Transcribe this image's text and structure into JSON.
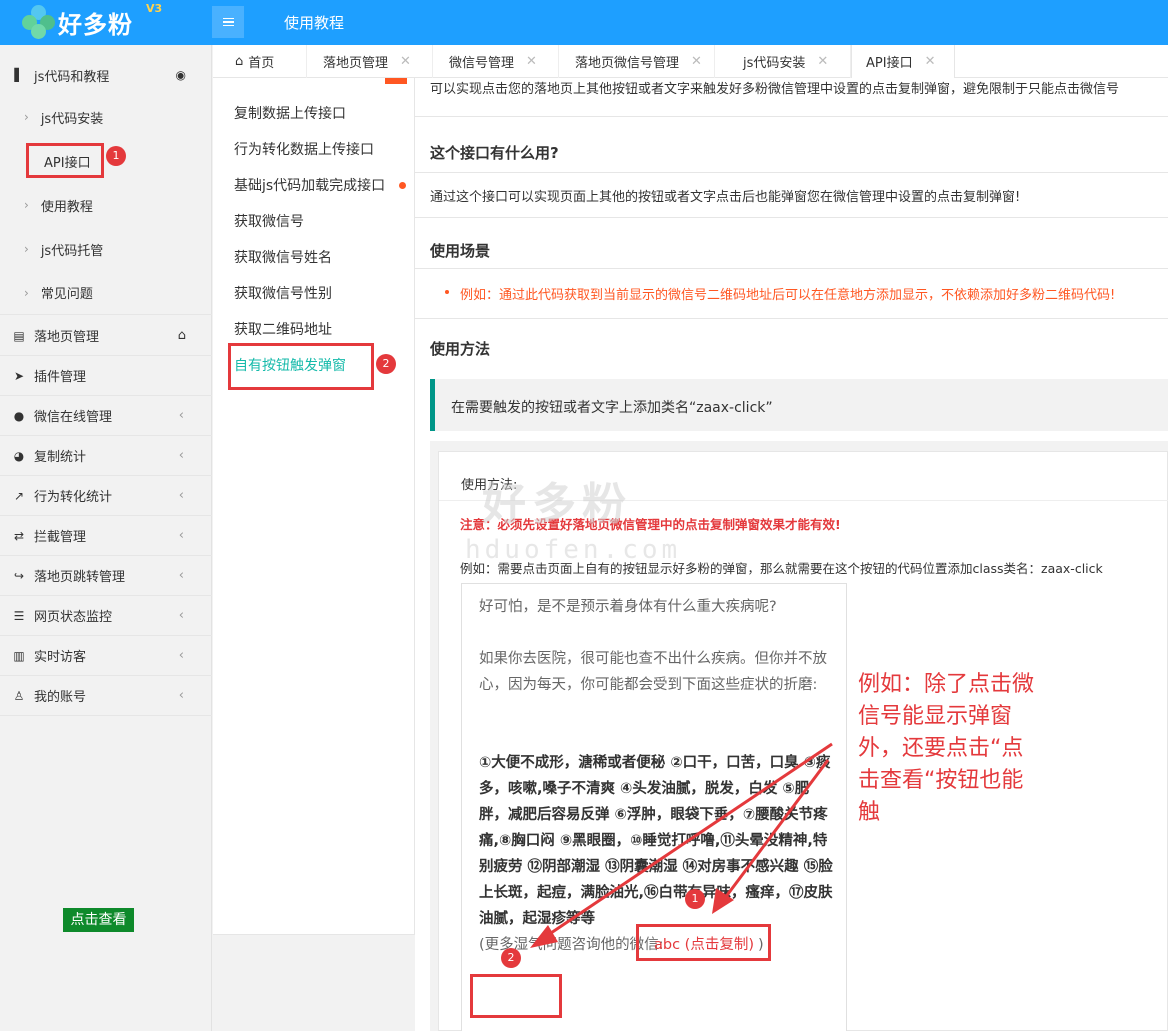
{
  "header": {
    "logo_text": "好多粉",
    "logo_version": "V3",
    "title": "使用教程"
  },
  "sidebar": {
    "group_title": "js代码和教程",
    "sub_items": [
      "js代码安装",
      "API接口",
      "使用教程",
      "js代码托管",
      "常见问题"
    ],
    "items": [
      {
        "label": "落地页管理",
        "icon": "file-icon"
      },
      {
        "label": "插件管理",
        "icon": "send-icon"
      },
      {
        "label": "微信在线管理",
        "icon": "wechat-icon"
      },
      {
        "label": "复制统计",
        "icon": "pie-chart-icon"
      },
      {
        "label": "行为转化统计",
        "icon": "line-chart-icon"
      },
      {
        "label": "拦截管理",
        "icon": "swap-icon"
      },
      {
        "label": "落地页跳转管理",
        "icon": "share-icon"
      },
      {
        "label": "网页状态监控",
        "icon": "server-icon"
      },
      {
        "label": "实时访客",
        "icon": "bar-chart-icon"
      },
      {
        "label": "我的账号",
        "icon": "user-icon"
      }
    ]
  },
  "tabs": [
    "首页",
    "落地页管理",
    "微信号管理",
    "落地页微信号管理",
    "js代码安装",
    "API接口"
  ],
  "midnav": {
    "items": [
      "复制数据上传接口",
      "行为转化数据上传接口",
      "基础js代码加载完成接口",
      "获取微信号",
      "获取微信号姓名",
      "获取微信号性别",
      "获取二维码地址",
      "自有按钮触发弹窗"
    ]
  },
  "content": {
    "intro": "可以实现点击您的落地页上其他按钮或者文字来触发好多粉微信管理中设置的点击复制弹窗，避免限制于只能点击微信号",
    "h1": "这个接口有什么用?",
    "p1": "通过这个接口可以实现页面上其他的按钮或者文字点击后也能弹窗您在微信管理中设置的点击复制弹窗!",
    "h2": "使用场景",
    "warn": "例如：通过此代码获取到当前显示的微信号二维码地址后可以在任意地方添加显示，不依赖添加好多粉二维码代码!",
    "h3": "使用方法",
    "quote": "在需要触发的按钮或者文字上添加类名“zaax-click”",
    "demo_title": "使用方法:",
    "demo_notice": "注意：必须先设置好落地页微信管理中的点击复制弹窗效果才能有效!",
    "demo_example": "例如：需要点击页面上自有的按钮显示好多粉的弹窗，那么就需要在这个按钮的代码位置添加class类名：zaax-click",
    "watermark": "好多粉",
    "watermark_url": "hduofen.com",
    "article": {
      "p1": "好可怕，是不是预示着身体有什么重大疾病呢?",
      "p2": "如果你去医院，很可能也查不出什么疾病。但你并不放心，因为每天，你可能都会受到下面这些症状的折磨:",
      "p3": "①大便不成形，溏稀或者便秘 ②口干，口苦，口臭 ③痰多，咳嗽,嗓子不清爽 ④头发油腻，脱发，白发 ⑤肥胖，减肥后容易反弹 ⑥浮肿，眼袋下垂，⑦腰酸关节疼痛,⑧胸口闷 ⑨黑眼圈，⑩睡觉打呼噜,⑪头晕没精神,特别疲劳 ⑫阴部潮湿 ⑬阴囊潮湿 ⑭对房事不感兴趣 ⑮脸上长斑，起痘，满脸油光,⑯白带有异味，瘙痒，⑰皮肤油腻，起湿疹等等",
      "p3_tail": "(更多湿气问题咨询他的微信:",
      "wechat_link": "abc (点击复制)",
      "close_paren": ")",
      "button": "点击查看"
    },
    "annotation": "例如：除了点击微信号能显示弹窗外，还要点击“点击查看“按钮也能触"
  },
  "badges": [
    "1",
    "2",
    "1",
    "2"
  ],
  "colors": {
    "primary": "#1e9fff",
    "accent_red": "#e4393c",
    "teal": "#16baaa",
    "green_button": "#0e8a2b"
  }
}
